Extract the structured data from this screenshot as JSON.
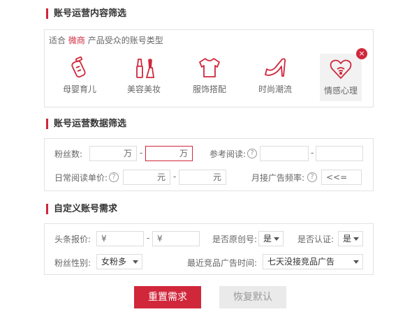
{
  "section1": {
    "title": "账号运营内容筛选",
    "suit_prefix": "适合",
    "suit_brand": "微商",
    "suit_suffix": "产品受众的账号类型",
    "categories": [
      {
        "label": "母婴育儿",
        "icon": "baby-bottle-icon"
      },
      {
        "label": "美容美妆",
        "icon": "makeup-icon"
      },
      {
        "label": "服饰搭配",
        "icon": "tshirt-icon"
      },
      {
        "label": "时尚潮流",
        "icon": "high-heel-icon"
      },
      {
        "label": "情感心理",
        "icon": "heart-icon"
      }
    ],
    "close_glyph": "×"
  },
  "section2": {
    "title": "账号运营数据筛选",
    "fans_label": "粉丝数:",
    "fans_unit": "万",
    "dash": "-",
    "ref_read_label": "参考阅读:",
    "daily_price_label": "日常阅读单价:",
    "price_unit": "元",
    "monthly_ad_label": "月接广告频率:",
    "monthly_ad_value": "<<=",
    "help_glyph": "?"
  },
  "section3": {
    "title": "自定义账号需求",
    "headline_price_label": "头条报价:",
    "currency": "¥",
    "original_label": "是否原创号:",
    "original_value": "是",
    "verified_label": "是否认证:",
    "verified_value": "是",
    "gender_label": "粉丝性别:",
    "gender_value": "女粉多",
    "recent_ad_label": "最近竞品广告时间:",
    "recent_ad_value": "七天没接竞品广告"
  },
  "actions": {
    "reset_label": "重置需求",
    "restore_label": "恢复默认"
  },
  "colors": {
    "accent": "#d0273b",
    "border": "#e2e2e2"
  }
}
